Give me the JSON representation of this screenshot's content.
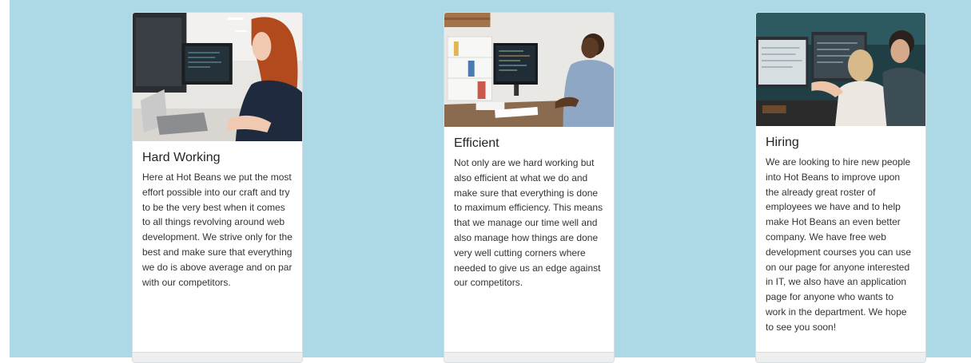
{
  "cards": [
    {
      "title": "Hard Working",
      "text": "Here at Hot Beans we put the most effort possible into our craft and try to be the very best when it comes to all things revolving around web development. We strive only for the best and make sure that everything we do is above average and on par with our competitors.",
      "image_icon": "photo-woman-at-computers"
    },
    {
      "title": "Efficient",
      "text": "Not only are we hard working but also efficient at what we do and make sure that everything is done to maximum efficiency. This means that we manage our time well and also manage how things are done very well cutting corners where needed to give us an edge against our competitors.",
      "image_icon": "photo-man-at-desk"
    },
    {
      "title": "Hiring",
      "text": "We are looking to hire new people into Hot Beans to improve upon the already great roster of employees we have and to help make Hot Beans an even better company. We have free web development courses you can use on our page for anyone interested in IT, we also have an application page for anyone who wants to work in the department. We hope to see you soon!",
      "image_icon": "photo-team-at-monitors"
    }
  ],
  "colors": {
    "background": "#add8e6",
    "card": "#ffffff",
    "title": "#212529",
    "text": "#333333"
  }
}
